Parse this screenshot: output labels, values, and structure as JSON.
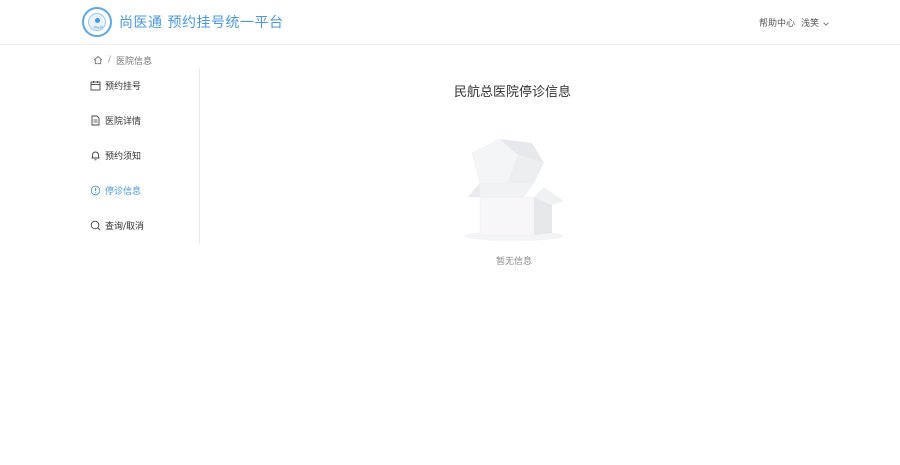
{
  "header": {
    "logo_text": "尚医通",
    "site_title": "尚医通 预约挂号统一平台",
    "help_label": "帮助中心",
    "user_name": "浅笑"
  },
  "breadcrumb": {
    "home_icon": "home-icon",
    "current": "医院信息"
  },
  "sidebar": {
    "items": [
      {
        "label": "预约挂号",
        "icon": "calendar-icon"
      },
      {
        "label": "医院详情",
        "icon": "document-icon"
      },
      {
        "label": "预约须知",
        "icon": "bell-icon"
      },
      {
        "label": "停诊信息",
        "icon": "info-circle-icon",
        "active": true
      },
      {
        "label": "查询/取消",
        "icon": "search-icon"
      }
    ]
  },
  "main": {
    "title": "民航总医院停诊信息",
    "empty_text": "暂无信息"
  },
  "colors": {
    "accent": "#4a98de",
    "text": "#333333"
  }
}
